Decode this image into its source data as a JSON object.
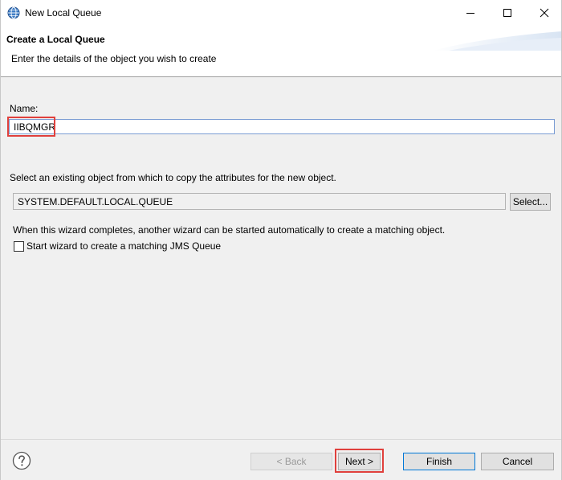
{
  "window": {
    "title": "New Local Queue",
    "icon": "globe-icon",
    "controls": [
      "minimize-icon",
      "maximize-icon",
      "close-icon"
    ]
  },
  "banner": {
    "title": "Create a Local Queue",
    "subtitle": "Enter the details of the object you wish to create"
  },
  "form": {
    "name_label": "Name:",
    "name_value": "IIBQMGR",
    "copy_label": "Select an existing object from which to copy the attributes for the new object.",
    "copy_value": "SYSTEM.DEFAULT.LOCAL.QUEUE",
    "select_button": "Select...",
    "wizard_text": "When this wizard completes, another wizard can be started automatically to create a matching object.",
    "jms_checkbox_label": "Start wizard to create a matching JMS Queue",
    "jms_checked": false
  },
  "footer": {
    "help_icon": "help-icon",
    "back_button": "< Back",
    "next_button": "Next >",
    "finish_button": "Finish",
    "cancel_button": "Cancel"
  },
  "colors": {
    "highlight": "#e0403c",
    "focus_border": "#0078d7"
  }
}
